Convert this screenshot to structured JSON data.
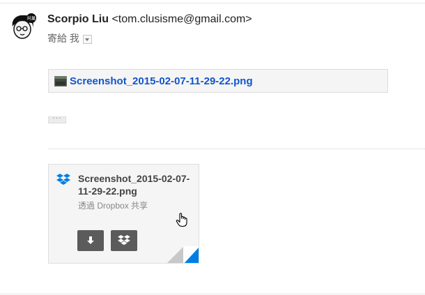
{
  "message": {
    "sender_name": "Scorpio Liu",
    "sender_email": "<tom.clusisme@gmail.com>",
    "recipient_label": "寄給 我"
  },
  "attachment": {
    "filename": "Screenshot_2015-02-07-11-29-22.png"
  },
  "trimmed_content": {
    "label": "···"
  },
  "dropbox_card": {
    "filename": "Screenshot_2015-02-07-11-29-22.png",
    "subtitle": "透過 Dropbox 共享"
  },
  "icons": {
    "avatar": "cartoon-avatar",
    "attachment_thumb": "image-thumbnail-icon",
    "dropbox": "dropbox-icon",
    "download": "download-icon",
    "save_to_dropbox": "dropbox-icon",
    "cursor": "hand-pointer-icon"
  },
  "colors": {
    "link": "#1155cc",
    "dropbox_blue": "#007ee5",
    "button_dark": "#5b5b5b"
  }
}
